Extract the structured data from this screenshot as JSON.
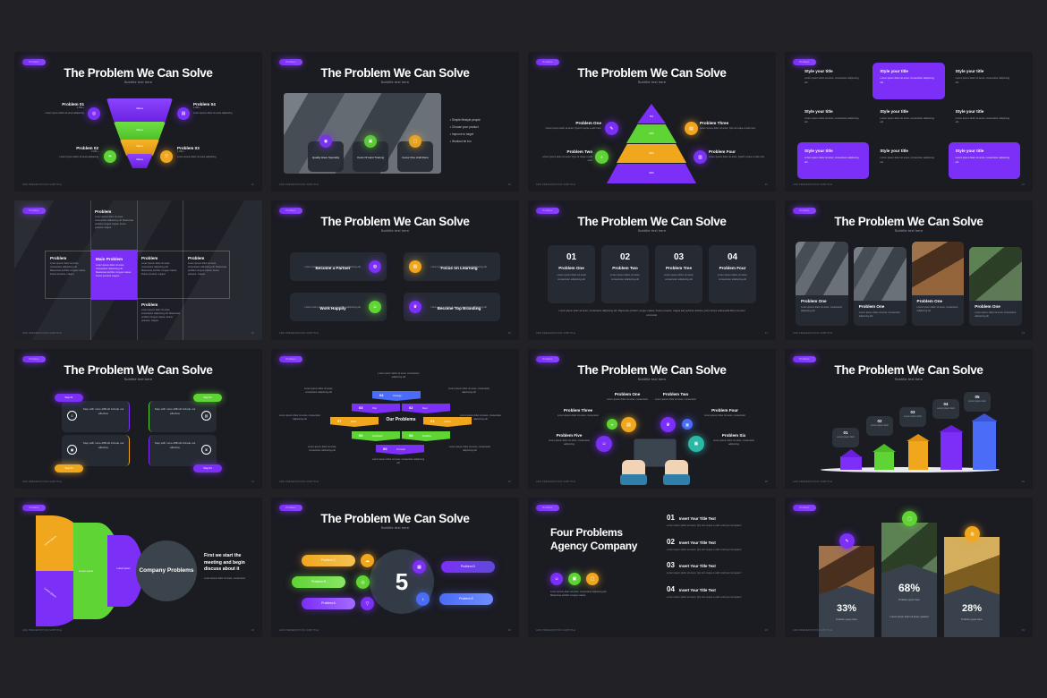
{
  "meta": {
    "background": "#212126",
    "slide_background": "#1b1b22",
    "accent_purple": "#7b2ff7",
    "accent_green": "#5fd435",
    "accent_orange": "#f0a71d",
    "accent_blue": "#4a6cf7"
  },
  "common": {
    "badge_label": "Problem",
    "title": "The Problem We Can Solve",
    "subtitle": "Subtitle text here",
    "footer_left": "ADD PRESENTATION SUBTITLE",
    "footer_right": "PAGE",
    "lorem_short": "Lorem ipsum dolor sit amet adipiscing",
    "lorem_med": "Lorem ipsum dolor sit amet, consectetur adipiscing elit.",
    "lorem_long": "Lorem ipsum dolor sit amet, consectetur adipiscing elit. Maecenas porttitor congue massa. Fusce posuere, magna sed pulvinar ultricies, purus lectus malesuada libero, sit amet commodo."
  },
  "slides": [
    {
      "id": "funnel",
      "page": "12",
      "funnel_label": "Values",
      "items": [
        {
          "title": "Problem 01",
          "sub": "1.801+",
          "body": "Lorem ipsum dolor sit amet adipiscing",
          "icon": "target-icon",
          "color": "#7b2ff7"
        },
        {
          "title": "Problem 04",
          "sub": "1.081+",
          "body": "Lorem ipsum dolor sit amet adipiscing",
          "icon": "book-icon",
          "color": "#7b2ff7"
        },
        {
          "title": "Problem 02",
          "sub": "2.181+",
          "body": "Lorem ipsum dolor sit amet adipiscing",
          "icon": "leaf-icon",
          "color": "#5fd435"
        },
        {
          "title": "Problem 03",
          "sub": "1.921+",
          "body": "Lorem ipsum dolor sit amet adipiscing",
          "icon": "rocket-icon",
          "color": "#f0a71d"
        }
      ]
    },
    {
      "id": "photo-bullets",
      "page": "24",
      "bullets": [
        "Simple lifestyle people",
        "Choose your product",
        "Improve to target",
        "Workout be fun"
      ],
      "cards": [
        {
          "label": "Quality Have Specialty",
          "icon": "badge-icon",
          "color": "#7b2ff7"
        },
        {
          "label": "Years Of Hard Training",
          "icon": "monitor-icon",
          "color": "#5fd435"
        },
        {
          "label": "Focus One Until Done",
          "icon": "camera-icon",
          "color": "#f0a71d"
        }
      ]
    },
    {
      "id": "pyramid",
      "page": "26",
      "tiers": [
        {
          "label": "5%",
          "color": "#7b2ff7"
        },
        {
          "label": "20%",
          "color": "#5fd435"
        },
        {
          "label": "35%",
          "color": "#f0a71d"
        },
        {
          "label": "30%",
          "color": "#7b2ff7"
        }
      ],
      "items": [
        {
          "title": "Problem One",
          "body": "Lorem ipsum dolor sit amet. Quod it reque a velit mod.",
          "icon": "pencil-icon",
          "color": "#7b2ff7"
        },
        {
          "title": "Problem Two",
          "body": "Lorem ipsum dolor sit amet. Quo sit reque a velit mod.",
          "icon": "search-icon",
          "color": "#5fd435"
        },
        {
          "title": "Problem Three",
          "body": "Lorem ipsum dolor sit amet. Quo sit reque a velit mod.",
          "icon": "folder-icon",
          "color": "#f0a71d"
        },
        {
          "title": "Problem Four",
          "body": "Lorem ipsum dolor sit amet. Quod it reque a velit mod.",
          "icon": "bag-icon",
          "color": "#7b2ff7"
        }
      ]
    },
    {
      "id": "style-grid",
      "page": "12",
      "cell_title": "Style your title",
      "cell_body": "Lorem ipsum dolor sit amet, consectetur adipiscing elit.",
      "highlighted": [
        1,
        6,
        8
      ]
    },
    {
      "id": "main-problem",
      "page": "18",
      "cells": [
        {
          "title": "Problem",
          "body": "Lorem ipsum dolor sit amet, consectetur adipiscing elit. Maecenas porttitor congue massa. Fusce posuere magna.",
          "highlight": false,
          "pos": "top"
        },
        {
          "title": "Problem",
          "body": "Lorem ipsum dolor sit amet, consectetur adipiscing elit. Maecenas porttitor congue massa. Fusce posuere, magna.",
          "highlight": false,
          "pos": "mid"
        },
        {
          "title": "Main Problem",
          "body": "Lorem ipsum dolor sit amet, consectetur adipiscing elit. Maecenas porttitor congue massa. Fusce posuere magna.",
          "highlight": true,
          "pos": "mid"
        },
        {
          "title": "Problem",
          "body": "Lorem ipsum dolor sit amet, consectetur adipiscing elit. Maecenas porttitor congue massa. Fusce posuere, magna.",
          "highlight": false,
          "pos": "mid"
        },
        {
          "title": "Problem",
          "body": "Lorem ipsum dolor sit amet, consectetur adipiscing elit. Maecenas porttitor congue massa. Fusce posuere, magna.",
          "highlight": false,
          "pos": "mid"
        },
        {
          "title": "Problem",
          "body": "Lorem ipsum dolor sit amet, consectetur adipiscing elit. Maecenas porttitor congue massa. Fusce posuere, magna.",
          "highlight": false,
          "pos": "bottom"
        }
      ]
    },
    {
      "id": "four-cards",
      "page": "19",
      "cards": [
        {
          "title": "Become a Partner",
          "body": "Lorem ipsum dolor sit amet, consectetur adipiscing elit.",
          "icon": "handshake-icon",
          "color": "#7b2ff7",
          "side": "right"
        },
        {
          "title": "Focus on Learning",
          "body": "Lorem ipsum dolor sit amet, consectetur adipiscing elit.",
          "icon": "book-icon",
          "color": "#f0a71d",
          "side": "left"
        },
        {
          "title": "Work Happily",
          "body": "Lorem ipsum dolor sit amet, consectetur adipiscing elit.",
          "icon": "smile-icon",
          "color": "#5fd435",
          "side": "right"
        },
        {
          "title": "Become Top Branding",
          "body": "Lorem ipsum dolor sit amet, consectetur adipiscing elit.",
          "icon": "trophy-icon",
          "color": "#7b2ff7",
          "side": "left"
        }
      ]
    },
    {
      "id": "numbered-cards",
      "page": "21",
      "footer_note": "Lorem ipsum dolor sit amet, consectetur adipiscing elit. Maecenas porttitor congue massa. Fusce posuere, magna sed pulvinar ultricies, purus lectus malesuada libero sit amet commodo.",
      "cards": [
        {
          "num": "01",
          "title": "Problem One",
          "body": "Lorem ipsum dolor sit amet consectetur adipiscing elit"
        },
        {
          "num": "02",
          "title": "Problem Two",
          "body": "Lorem ipsum dolor sit amet, consectetur adipiscing elit"
        },
        {
          "num": "03",
          "title": "Problem Tree",
          "body": "Lorem ipsum dolor sit amet, consectetur adipiscing elit"
        },
        {
          "num": "04",
          "title": "Problem Four",
          "body": "Lorem ipsum dolor sit amet, consectetur adipiscing elit"
        }
      ]
    },
    {
      "id": "photo-cards",
      "page": "23",
      "cards": [
        {
          "title": "Problem One",
          "body": "Lorem ipsum dolor sit amet, consectetur adipiscing elit",
          "tone": "cool"
        },
        {
          "title": "Problem One",
          "body": "Lorem ipsum dolor sit amet, consectetur adipiscing elit",
          "tone": "grey"
        },
        {
          "title": "Problem One",
          "body": "Lorem ipsum dolor sit amet, consectetur adipiscing elit",
          "tone": "warm"
        },
        {
          "title": "Problem One",
          "body": "Lorem ipsum dolor sit amet, consectetur adipiscing elit",
          "tone": "green"
        }
      ]
    },
    {
      "id": "steps",
      "page": "14",
      "cards": [
        {
          "pill": "Step 01",
          "body": "Step with more difficult include out effective",
          "icon": "smile-icon",
          "color": "#7b2ff7"
        },
        {
          "pill": "Step 02",
          "body": "Step with more difficult include out effective",
          "icon": "print-icon",
          "color": "#5fd435"
        },
        {
          "pill": "Step 03",
          "body": "Step with more difficult include out effective",
          "icon": "monitor-icon",
          "color": "#f0a71d"
        },
        {
          "pill": "Step 04",
          "body": "Step with more difficult include out effective",
          "icon": "trophy-icon",
          "color": "#7b2ff7"
        }
      ]
    },
    {
      "id": "our-problems",
      "page": "16",
      "center": "Our Problems",
      "banners": [
        {
          "num": "04",
          "label": "Strategy",
          "color": "#4a6cf7"
        },
        {
          "num": "03",
          "label": "Plan",
          "color": "#7b2ff7"
        },
        {
          "num": "02",
          "label": "Meet",
          "color": "#7b2ff7"
        },
        {
          "num": "07",
          "label": "Build",
          "color": "#f0a71d"
        },
        {
          "num": "01",
          "label": "Create",
          "color": "#f0a71d"
        },
        {
          "num": "06",
          "label": "Feedback",
          "color": "#5fd435"
        },
        {
          "num": "08",
          "label": "Deadline",
          "color": "#5fd435"
        },
        {
          "num": "05",
          "label": "Promote",
          "color": "#7b2ff7"
        }
      ],
      "notes": [
        "Lorem ipsum dolor sit amet, consectetur adipiscing elit",
        "Lorem ipsum dolor sit amet, consectetur adipiscing elit",
        "Lorem ipsum dolor sit amet, consectetur adipiscing elit",
        "Lorem ipsum dolor sit amet, consectetur adipiscing elit",
        "Lorem ipsum dolor sit amet, consectetur adipiscing elit",
        "Lorem ipsum dolor sit amet, consectetur adipiscing elit"
      ]
    },
    {
      "id": "tablet",
      "page": "28",
      "items": [
        {
          "title": "Problem One",
          "body": "Lorem ipsum dolor sit amet, consectetur",
          "icon": "folder-icon",
          "color": "#f0a71d"
        },
        {
          "title": "Problem Two",
          "body": "Lorem ipsum dolor sit amet, consectetur",
          "icon": "trophy-icon",
          "color": "#7b2ff7"
        },
        {
          "title": "Problem Three",
          "body": "Lorem ipsum dolor sit amet, consectetur",
          "icon": "leaf-icon",
          "color": "#5fd435"
        },
        {
          "title": "Problem Four",
          "body": "Lorem ipsum dolor sit amet, consectetur",
          "icon": "grid-icon",
          "color": "#4a6cf7"
        },
        {
          "title": "Problem Five",
          "body": "Lorem ipsum dolor sit amet, consectetur adipiscing",
          "icon": "smile-icon",
          "color": "#7b2ff7"
        },
        {
          "title": "Problem Six",
          "body": "Lorem ipsum dolor sit amet, consectetur adipiscing",
          "icon": "note-icon",
          "color": "#2bb8a6"
        }
      ]
    },
    {
      "id": "buildings",
      "page": "15",
      "steps": [
        {
          "num": "01",
          "body": "Lorem ipsum dolor",
          "color": "#7b2ff7"
        },
        {
          "num": "02",
          "body": "Lorem ipsum dolor",
          "color": "#5fd435"
        },
        {
          "num": "03",
          "body": "Lorem ipsum dolor",
          "color": "#f0a71d"
        },
        {
          "num": "04",
          "body": "Lorem ipsum dolor",
          "color": "#7b2ff7"
        },
        {
          "num": "05",
          "body": "Lorem ipsum dolor",
          "color": "#4a6cf7"
        }
      ]
    },
    {
      "id": "company-problems",
      "page": "10",
      "center_label": "Company Problems",
      "arcs": [
        {
          "label": "Lorem ipsum",
          "color": "#f0a71d"
        },
        {
          "label": "Lorem ipsum",
          "color": "#7b2ff7"
        },
        {
          "label": "Lorem ipsum",
          "color": "#5fd435"
        },
        {
          "label": "Lorem Ipsum",
          "color": "#7b2ff7"
        }
      ],
      "headline": "First we start the meeting and begin discuss about it",
      "body": "Lorem ipsum dolor sit amet, consectetur"
    },
    {
      "id": "big-five",
      "page": "20",
      "number": "5",
      "left": [
        {
          "label": "Problem C",
          "icon": "cloud-icon",
          "color": "#f0a71d"
        },
        {
          "label": "Problem B",
          "icon": "target-icon",
          "color": "#5fd435"
        },
        {
          "label": "Problem A",
          "icon": "rocket-icon",
          "color": "#7b2ff7"
        }
      ],
      "right": [
        {
          "label": "Problem D",
          "icon": "grid-icon",
          "color": "#7b2ff7"
        },
        {
          "label": "Problem E",
          "icon": "bell-icon",
          "color": "#4a6cf7"
        }
      ]
    },
    {
      "id": "agency",
      "page": "18",
      "headline": "Four Problems Agency Company",
      "body": "Lorem ipsum dolor sit amet, consectetur adipiscing elit. Maecenas porttitor congue massa.",
      "icons": [
        {
          "icon": "smile-icon",
          "color": "#7b2ff7"
        },
        {
          "icon": "monitor-icon",
          "color": "#5fd435"
        },
        {
          "icon": "camera-icon",
          "color": "#f0a71d"
        }
      ],
      "list": [
        {
          "num": "01",
          "title": "Insert Your Title Text",
          "body": "Lorem ipsum dolor sit amet. Qui sint neque a velit modi qui numquam!"
        },
        {
          "num": "02",
          "title": "Insert Your Title Text",
          "body": "Lorem ipsum dolor sit amet. Qui sint neque a velit modi qui numquam!"
        },
        {
          "num": "03",
          "title": "Insert Your Title Text",
          "body": "Lorem ipsum dolor sit amet. Qui sint neque a velit modi qui numquam!"
        },
        {
          "num": "04",
          "title": "Insert Your Title Text",
          "body": "Lorem ipsum dolor sit amet. Qui sint neque a velit modi qui numquam!"
        }
      ]
    },
    {
      "id": "percent",
      "page": "25",
      "columns": [
        {
          "pct": "33%",
          "caption": "Problem goes here",
          "icon": "pencil-icon",
          "color": "#7b2ff7",
          "tone": "warm",
          "body": ""
        },
        {
          "pct": "68%",
          "caption": "Problem goes here",
          "icon": "camera-icon",
          "color": "#5fd435",
          "tone": "green",
          "body": "Lorem ipsum dolor sit amet, quaerat"
        },
        {
          "pct": "28%",
          "caption": "Problem goes here",
          "icon": "bulb-icon",
          "color": "#f0a71d",
          "tone": "gold",
          "body": ""
        }
      ]
    }
  ]
}
